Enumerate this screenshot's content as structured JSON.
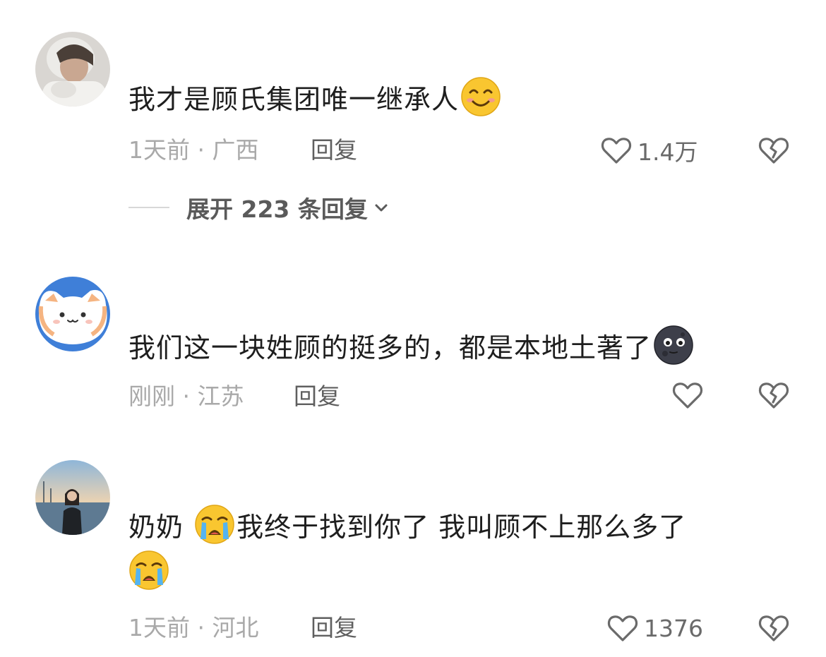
{
  "comments": [
    {
      "text_before": "我才是顾氏集团唯一继承人",
      "emoji_after": "smiling-face-emoji",
      "time": "1天前",
      "sep": " · ",
      "location": "广西",
      "reply_label": "回复",
      "like_count": "1.4万",
      "expand_label": "展开 223 条回复"
    },
    {
      "text_before": "我们这一块姓顾的挺多的，都是本地土著了",
      "emoji_after": "dark-moon-face-emoji",
      "time": "刚刚",
      "sep": " · ",
      "location": "江苏",
      "reply_label": "回复",
      "like_count": ""
    },
    {
      "text_prefix": "奶奶",
      "emoji_mid": "crying-face-emoji",
      "text_after": "我终于找到你了 我叫顾不上那么多了",
      "emoji_end": "crying-face-emoji",
      "time": "1天前",
      "sep": " · ",
      "location": "河北",
      "reply_label": "回复",
      "like_count": "1376"
    }
  ],
  "colors": {
    "meta": "#a9a9a9",
    "reply": "#5f5f5f",
    "text": "#1e1e1e",
    "icon": "#6a6a6a"
  }
}
